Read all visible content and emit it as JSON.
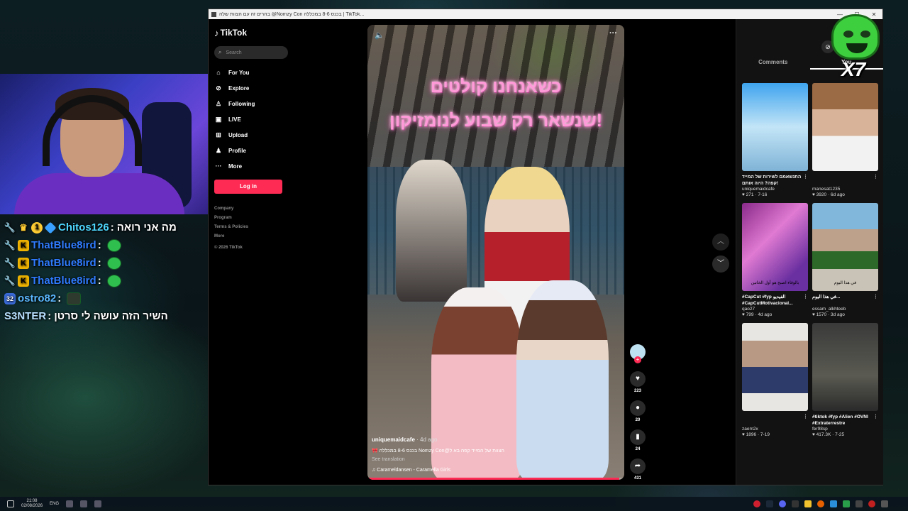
{
  "browser": {
    "tab_title": "בהרים זה עם הצוות שלה @Nomzy Con בכנס 8-6 במכללה | TikTok..."
  },
  "tiktok_nav": {
    "logo": "TikTok",
    "search_placeholder": "Search",
    "items": [
      {
        "icon": "home-icon",
        "glyph": "⌂",
        "label": "For You"
      },
      {
        "icon": "compass-icon",
        "glyph": "⊘",
        "label": "Explore"
      },
      {
        "icon": "people-icon",
        "glyph": "♙",
        "label": "Following"
      },
      {
        "icon": "live-icon",
        "glyph": "▣",
        "label": "LIVE"
      },
      {
        "icon": "upload-icon",
        "glyph": "⊞",
        "label": "Upload"
      },
      {
        "icon": "profile-icon",
        "glyph": "♟",
        "label": "Profile"
      },
      {
        "icon": "more-icon",
        "glyph": "···",
        "label": "More"
      }
    ],
    "login_label": "Log in",
    "footer": {
      "links": [
        "Company",
        "Program",
        "Terms & Policies",
        "More"
      ],
      "copyright": "© 2026 TikTok"
    }
  },
  "video": {
    "caption_line1": "כשאנחנו קולטים",
    "caption_line2": "!שנשאר רק שבוע לנומזיקון",
    "author": "uniquemaidcafe",
    "time_ago": "· 4d ago",
    "description": "הצוות של המייד קפה בא ל@Nomzy Con בכנס 8-6 במכללה 🎀",
    "see_translation": "See translation",
    "music": "♫ Carameldansen - Caramella Girls",
    "progress_fraction": 0.98
  },
  "actions": [
    {
      "icon": "heart-icon",
      "glyph": "♥",
      "count": "223"
    },
    {
      "icon": "comment-icon",
      "glyph": "●",
      "count": "20"
    },
    {
      "icon": "bookmark-icon",
      "glyph": "▮",
      "count": "24"
    },
    {
      "icon": "share-icon",
      "glyph": "➦",
      "count": "431"
    }
  ],
  "right_panel": {
    "tabs": [
      "Comments",
      "You"
    ],
    "cards": [
      {
        "caption": "התנשאמם לשירות של המייד קפה? היוה אותם!",
        "user": "uniquemaidcafe",
        "views": "271",
        "date": "7-16",
        "thumb_label": ""
      },
      {
        "caption": "",
        "user": "manesat1235",
        "views": "3920",
        "date": "6d ago",
        "thumb_label": ""
      },
      {
        "caption": "#CapCut #fyp الفيديو #CapCutMotivacional...",
        "user": "qao27",
        "views": "799",
        "date": "4d ago",
        "thumb_label": "بالوقاء اصبح هو أول الخاتين"
      },
      {
        "caption": "في هذا اليوم...",
        "user": "essam_alkhteeb",
        "views": "1570",
        "date": "3d ago",
        "thumb_label": "في هذا اليوم"
      },
      {
        "caption": "",
        "user": "zaem2x",
        "views": "1896",
        "date": "7-19",
        "thumb_label": ""
      },
      {
        "caption": "#tiktok #fyp #Alien #OVNI #Extraterrestre",
        "user": "fer98sp",
        "views": "417.3K",
        "date": "7-25",
        "thumb_label": ""
      }
    ]
  },
  "stream_chat": [
    {
      "badges": [
        "wrench",
        "crown",
        "num:1",
        "gem"
      ],
      "user": "Chitos126",
      "color": "#4fd8ff",
      "message": "מה אני רואה",
      "emote": false
    },
    {
      "badges": [
        "wrench",
        "k"
      ],
      "user": "ThatBlue8ird",
      "color": "#2f7cff",
      "message": "",
      "emote": true
    },
    {
      "badges": [
        "wrench",
        "k"
      ],
      "user": "ThatBlue8ird",
      "color": "#2f7cff",
      "message": "",
      "emote": true
    },
    {
      "badges": [
        "wrench",
        "k"
      ],
      "user": "ThatBlue8ird",
      "color": "#2f7cff",
      "message": "",
      "emote": true
    },
    {
      "badges": [
        "s32"
      ],
      "user": "ostro82",
      "color": "#5ab8ff",
      "message": "",
      "emote": true
    },
    {
      "badges": [],
      "user": "S3NTER",
      "color": "#b8e0ff",
      "message": "השיר הזה עושה לי סרטן",
      "emote": false
    }
  ],
  "overlay": {
    "multiplier": "X7"
  },
  "taskbar": {
    "time": "21:08",
    "date": "02/08/2026",
    "lang": "ENG"
  }
}
